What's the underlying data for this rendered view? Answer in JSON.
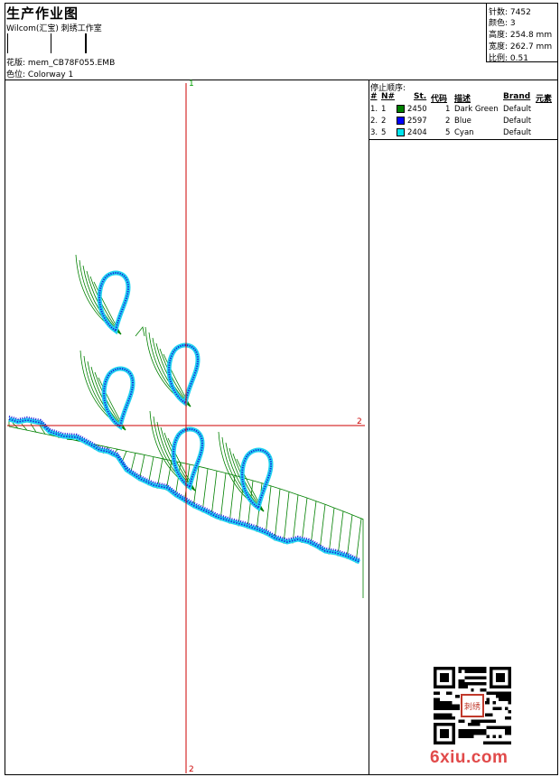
{
  "header": {
    "title": "生产作业图",
    "company": "Wilcom(汇宝) 刺绣工作室",
    "design_label": "花版:",
    "design_value": "mem_CB78F055.EMB",
    "colorway_label": "色位:",
    "colorway_value": "Colorway 1"
  },
  "stats": [
    {
      "label": "针数:",
      "value": "7452"
    },
    {
      "label": "颜色:",
      "value": "3"
    },
    {
      "label": "高度:",
      "value": "254.8 mm"
    },
    {
      "label": "宽度:",
      "value": "262.7 mm"
    },
    {
      "label": "比例:",
      "value": "0.51"
    }
  ],
  "legend": {
    "title": "停止顺序:",
    "headers": {
      "num": "#",
      "needle": "N#",
      "st": "St.",
      "code": "代码",
      "desc": "描述",
      "brand": "Brand",
      "element": "元素"
    },
    "rows": [
      {
        "num": "1.",
        "needle": "1",
        "color": "#008000",
        "st": "2450",
        "code": "1",
        "desc": "Dark Green",
        "brand": "Default"
      },
      {
        "num": "2.",
        "needle": "2",
        "color": "#0000ff",
        "st": "2597",
        "code": "2",
        "desc": "Blue",
        "brand": "Default"
      },
      {
        "num": "3.",
        "needle": "5",
        "color": "#00e5ee",
        "st": "2404",
        "code": "5",
        "desc": "Cyan",
        "brand": "Default"
      }
    ]
  },
  "axes": {
    "v_top": "1",
    "h_right": "2",
    "v_bottom": "2"
  },
  "colors": {
    "green": "#008000",
    "blue": "#1a1adb",
    "cyan": "#22d3f0",
    "axis": "#cc0000"
  },
  "watermark": "6xiu.com",
  "seal_text": "刺绣"
}
